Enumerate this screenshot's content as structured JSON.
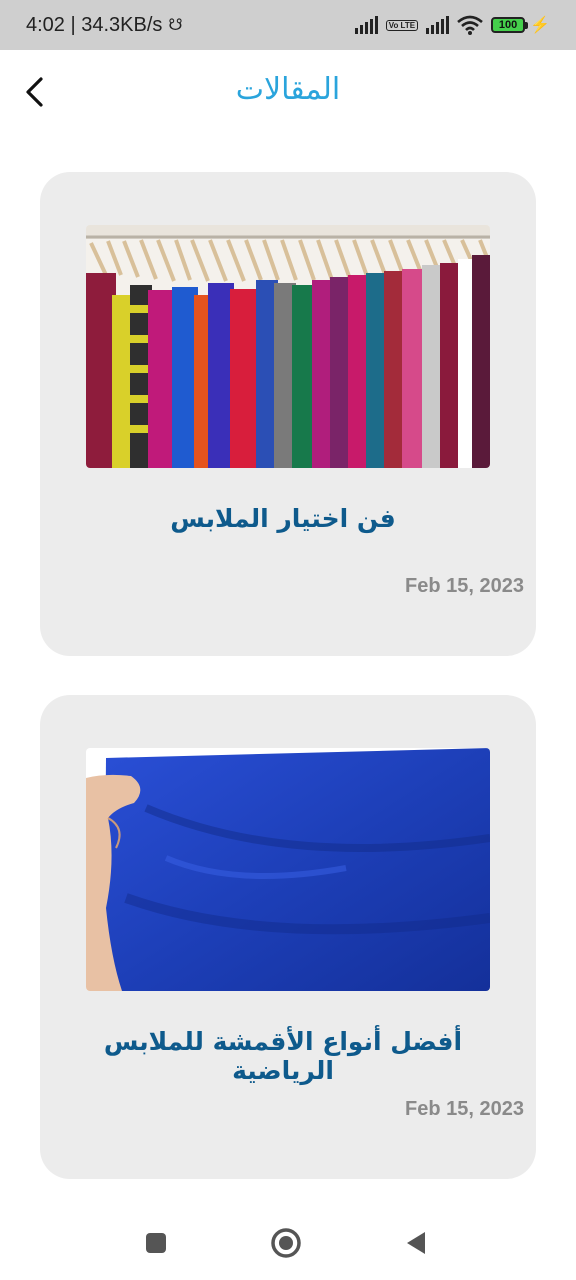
{
  "status_bar": {
    "time_speed": "4:02 | 34.3KB/s",
    "volte": "Vo LTE",
    "battery": "100"
  },
  "header": {
    "title": "المقالات"
  },
  "articles": [
    {
      "title": "فن اختيار الملابس",
      "date": "Feb 15, 2023",
      "image": "colorful-shirts-on-hangers"
    },
    {
      "title": "أفضل أنواع الأقمشة للملابس الرياضية",
      "date": "Feb 15, 2023",
      "image": "blue-fabric-in-hand"
    }
  ],
  "colors": {
    "title": "#2aa4dc",
    "card_title": "#0e5a8c",
    "card_bg": "#ececec",
    "date": "#8a8a8a"
  },
  "icons": {
    "back": "chevron-left-icon",
    "nav_recent": "square-icon",
    "nav_home": "circle-icon",
    "nav_back": "triangle-back-icon"
  }
}
